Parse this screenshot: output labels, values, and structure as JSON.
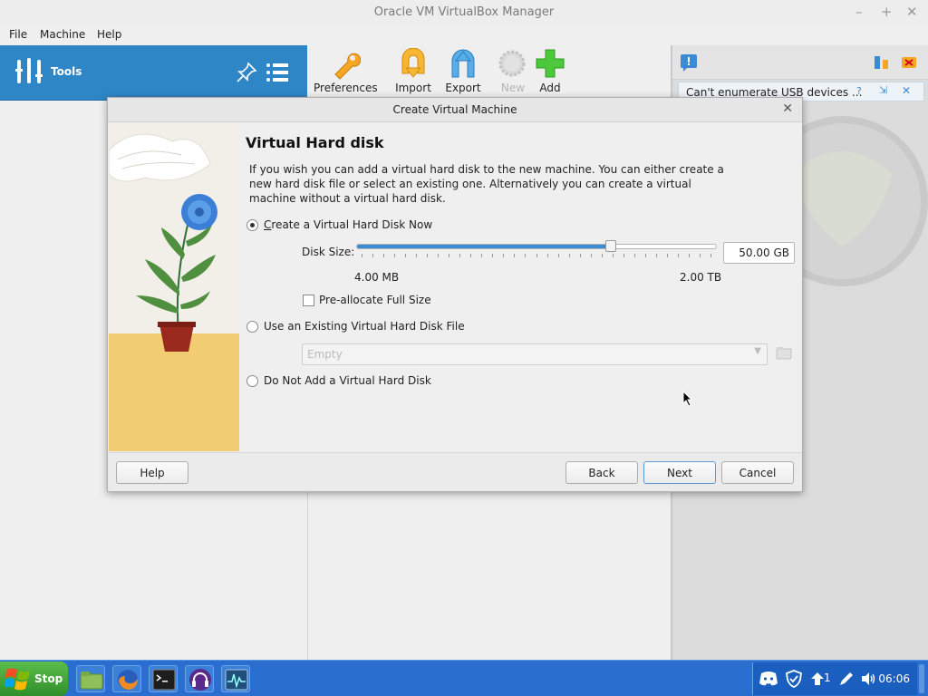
{
  "window": {
    "title": "Oracle VM VirtualBox Manager"
  },
  "menu": {
    "file": "File",
    "machine": "Machine",
    "help": "Help"
  },
  "tools": {
    "label": "Tools"
  },
  "toolbar": {
    "preferences": "Preferences",
    "import": "Import",
    "export": "Export",
    "new": "New",
    "add": "Add"
  },
  "notification": {
    "text": "Can't enumerate USB devices ..."
  },
  "dialog": {
    "title": "Create Virtual Machine",
    "heading": "Virtual Hard disk",
    "description": "If you wish you can add a virtual hard disk to the new machine. You can either create a new hard disk file or select an existing one. Alternatively you can create a virtual machine without a virtual hard disk.",
    "options": {
      "create_now": "Create a Virtual Hard Disk Now",
      "use_existing": "Use an Existing Virtual Hard Disk File",
      "no_disk": "Do Not Add a Virtual Hard Disk",
      "selected": "create_now"
    },
    "disk_size": {
      "label": "Disk Size:",
      "value": "50.00 GB",
      "min_label": "4.00 MB",
      "max_label": "2.00 TB",
      "slider_fraction": 0.705
    },
    "preallocate": {
      "label": "Pre-allocate Full Size",
      "checked": false
    },
    "existing_file": {
      "value": "Empty"
    },
    "buttons": {
      "help": "Help",
      "back": "Back",
      "next": "Next",
      "cancel": "Cancel"
    }
  },
  "taskbar": {
    "start_label": "Stop",
    "clock": "06:06",
    "tray_badge": "1"
  },
  "colors": {
    "accent": "#2f86c6",
    "taskbar": "#2a6fd0",
    "slider": "#3b8ad4"
  }
}
